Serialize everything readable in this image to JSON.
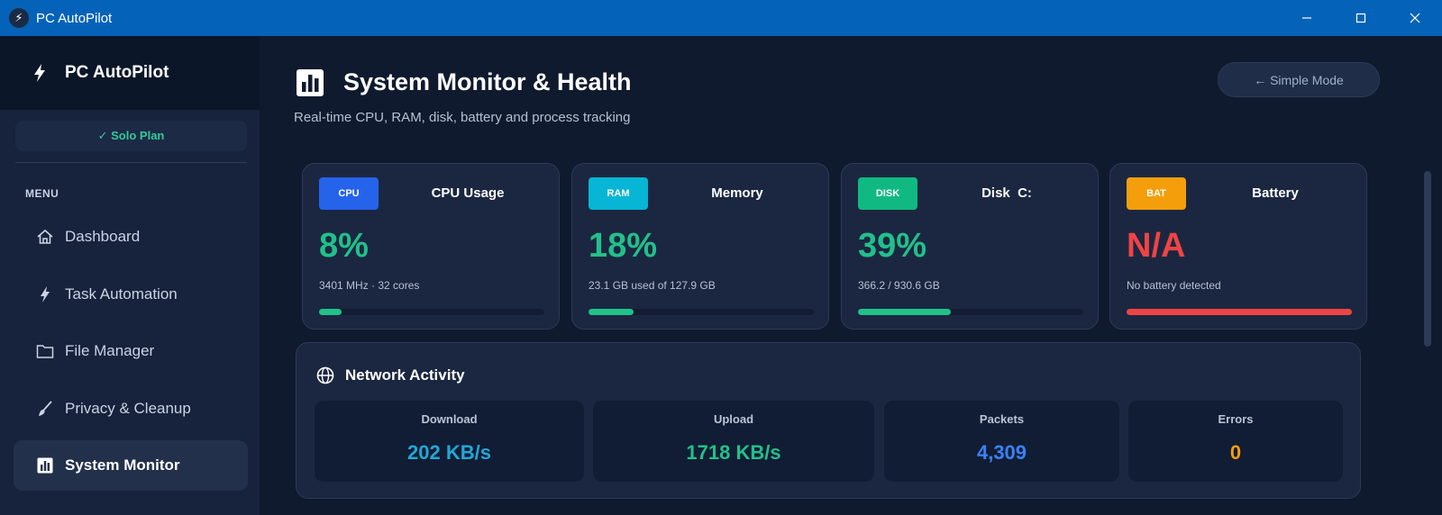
{
  "window": {
    "title": "PC AutoPilot",
    "controls": {
      "minimize": "—",
      "maximize": "☐",
      "close": "✕"
    }
  },
  "sidebar": {
    "brand": "PC AutoPilot",
    "plan": "✓ Solo Plan",
    "menu_label": "MENU",
    "items": [
      {
        "label": "Dashboard",
        "icon": "home-icon"
      },
      {
        "label": "Task Automation",
        "icon": "bolt-icon"
      },
      {
        "label": "File Manager",
        "icon": "folder-icon"
      },
      {
        "label": "Privacy & Cleanup",
        "icon": "brush-icon"
      },
      {
        "label": "System Monitor",
        "icon": "chart-icon",
        "active": true
      }
    ]
  },
  "header": {
    "title": "System Monitor & Health",
    "subtitle": "Real-time CPU, RAM, disk, battery and process tracking",
    "simple_mode": "← Simple Mode"
  },
  "cards": [
    {
      "badge": "CPU",
      "title": "CPU Usage",
      "value": "8%",
      "detail": "3401 MHz · 32 cores",
      "percent": 10,
      "badge_color": "#2563eb",
      "value_color": "#22c08a",
      "bar_color": "#22c08a"
    },
    {
      "badge": "RAM",
      "title": "Memory",
      "value": "18%",
      "detail": "23.1 GB used of 127.9 GB",
      "percent": 20,
      "badge_color": "#06b6d4",
      "value_color": "#22c08a",
      "bar_color": "#22c08a"
    },
    {
      "badge": "DISK",
      "title": "Disk  C:",
      "value": "39%",
      "detail": "366.2 / 930.6 GB",
      "percent": 41,
      "badge_color": "#10b981",
      "value_color": "#22c08a",
      "bar_color": "#22c08a"
    },
    {
      "badge": "BAT",
      "title": "Battery",
      "value": "N/A",
      "detail": "No battery detected",
      "percent": 100,
      "badge_color": "#f59e0b",
      "value_color": "#ef4444",
      "bar_color": "#ef4444"
    }
  ],
  "network": {
    "title": "Network Activity",
    "stats": [
      {
        "label": "Download",
        "value": "202 KB/s",
        "color": "#22a7d6"
      },
      {
        "label": "Upload",
        "value": "1718 KB/s",
        "color": "#22c08a"
      },
      {
        "label": "Packets",
        "value": "4,309",
        "color": "#3b82f6"
      },
      {
        "label": "Errors",
        "value": "0",
        "color": "#f59e0b"
      }
    ]
  }
}
